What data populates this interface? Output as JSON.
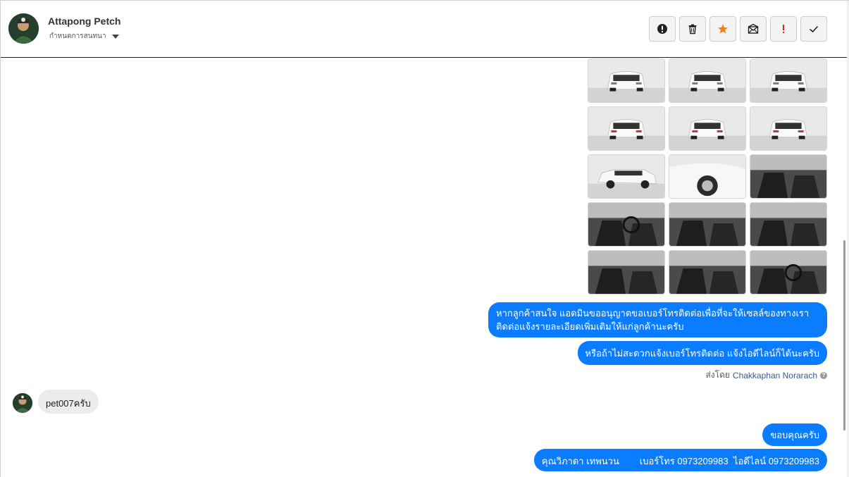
{
  "header": {
    "contact_name": "Attapong Petch",
    "subtitle": "กำหนดการสนทนา",
    "actions": [
      {
        "name": "mark-spam-button",
        "icon": "alert-circle-icon"
      },
      {
        "name": "delete-button",
        "icon": "trash-icon"
      },
      {
        "name": "star-button",
        "icon": "star-icon"
      },
      {
        "name": "mark-unread-button",
        "icon": "envelope-icon"
      },
      {
        "name": "mark-important-button",
        "icon": "exclamation-icon"
      },
      {
        "name": "mark-done-button",
        "icon": "check-icon"
      }
    ]
  },
  "colors": {
    "accent": "#0a7cff",
    "star": "#f5821f",
    "important": "#e02020",
    "incoming_bubble": "#ececec"
  },
  "photos": [
    {
      "kind": "car-front-left"
    },
    {
      "kind": "car-front"
    },
    {
      "kind": "car-front-right"
    },
    {
      "kind": "car-rear-left"
    },
    {
      "kind": "car-rear"
    },
    {
      "kind": "car-rear-right"
    },
    {
      "kind": "car-side"
    },
    {
      "kind": "car-wheel-closeup"
    },
    {
      "kind": "door-interior"
    },
    {
      "kind": "dashboard"
    },
    {
      "kind": "gear-console"
    },
    {
      "kind": "front-seats"
    },
    {
      "kind": "rear-seat"
    },
    {
      "kind": "rear-bench"
    },
    {
      "kind": "cabin-overview"
    }
  ],
  "messages": {
    "outgoing_1": "หากลูกค้าสนใจ แอดมินขออนุญาตขอเบอร์โทรติดต่อเพื่อที่จะให้เซลล์ของทางเราติดต่อแจ้งรายละเอียดเพิ่มเติมให้แก่ลูกค้านะครับ",
    "outgoing_2": "หรือถ้าไม่สะดวกแจ้งเบอร์โทรติดต่อ แจ้งไอดีไลน์ก็ได้นะครับ",
    "sent_by_prefix": "ส่งโดย",
    "sent_by_agent": "Chakkaphan Norarach",
    "help_glyph": "?",
    "incoming_1": "pet007ครับ",
    "outgoing_3": "ขอบคุณครับ",
    "outgoing_4": "คุณวิภาดา เทพนวน        เบอร์โทร 0973209983  ไอดีไลน์ 0973209983"
  }
}
